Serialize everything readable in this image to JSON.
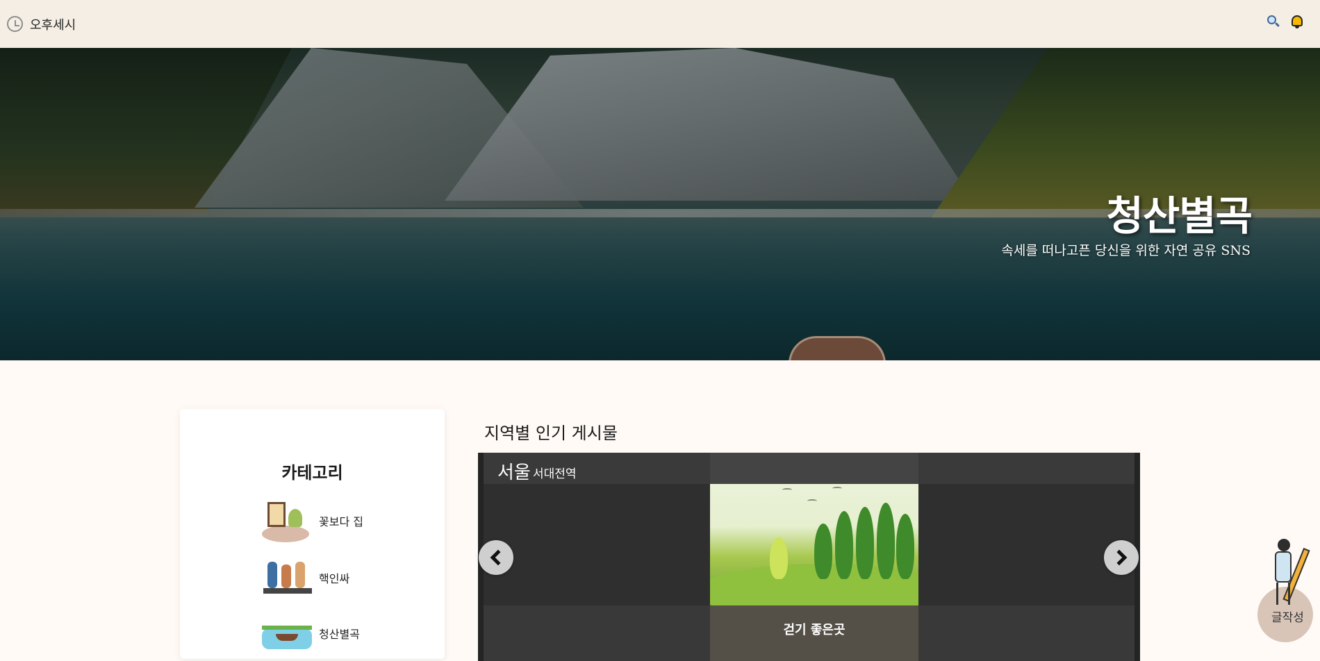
{
  "topbar": {
    "brand": "오후세시",
    "icons": {
      "clock": "clock-icon",
      "search": "search-icon",
      "notifications": "bell-icon"
    }
  },
  "hero": {
    "title": "청산별곡",
    "subtitle": "속세를 떠나고픈 당신을 위한 자연 공유 SNS"
  },
  "sidebar": {
    "title": "카테고리",
    "items": [
      {
        "label": "꽃보다 집"
      },
      {
        "label": "핵인싸"
      },
      {
        "label": "청산별곡"
      }
    ]
  },
  "main": {
    "section_title": "지역별 인기 게시물",
    "carousel": {
      "region": "서울",
      "station": "서대전역",
      "caption": "걷기 좋은곳"
    }
  },
  "fab": {
    "label": "글작성"
  },
  "colors": {
    "topbar_bg": "#f5eee5",
    "page_bg": "#fffaf6",
    "carousel_bg": "#2f2f2f"
  }
}
